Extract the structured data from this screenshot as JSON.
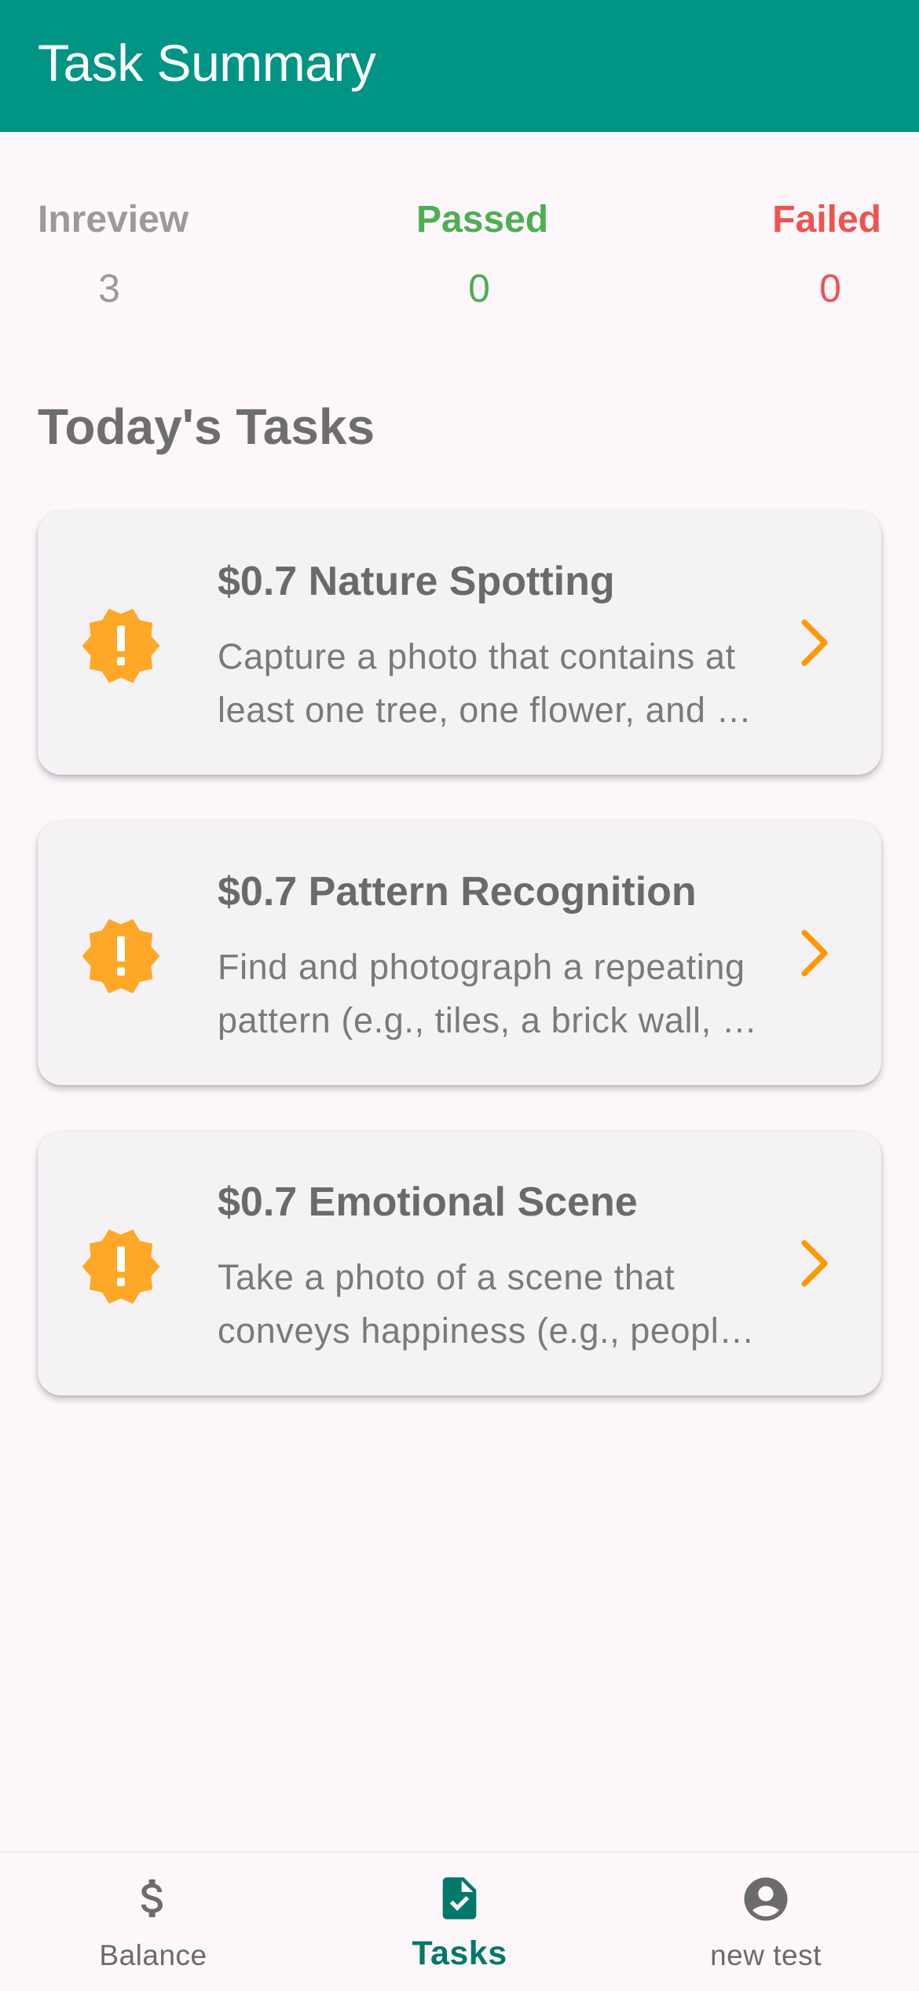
{
  "appbar": {
    "title": "Task Summary",
    "color": "#009485"
  },
  "summary": {
    "inreview": {
      "label": "Inreview",
      "value": "3",
      "color": "#9a9a9a"
    },
    "passed": {
      "label": "Passed",
      "value": "0",
      "color": "#4caf50"
    },
    "failed": {
      "label": "Failed",
      "value": "0",
      "color": "#ef5350"
    }
  },
  "section_title": "Today's Tasks",
  "tasks": [
    {
      "title": "$0.7 Nature Spotting",
      "description": "Capture a photo that contains at least one tree, one flower, and …",
      "icon": "warning-badge-icon",
      "accent": "#ffa726"
    },
    {
      "title": "$0.7 Pattern Recognition",
      "description": "Find and photograph a repeating pattern (e.g., tiles, a brick wall, …",
      "icon": "warning-badge-icon",
      "accent": "#ffa726"
    },
    {
      "title": "$0.7 Emotional Scene",
      "description": "Take a photo of a scene that conveys happiness (e.g., peopl…",
      "icon": "warning-badge-icon",
      "accent": "#ffa726"
    }
  ],
  "bottom_nav": {
    "items": [
      {
        "label": "Balance",
        "icon": "dollar-icon",
        "active": false
      },
      {
        "label": "Tasks",
        "icon": "task-document-icon",
        "active": true
      },
      {
        "label": "new test",
        "icon": "account-circle-icon",
        "active": false
      }
    ],
    "active_color": "#00796b"
  }
}
